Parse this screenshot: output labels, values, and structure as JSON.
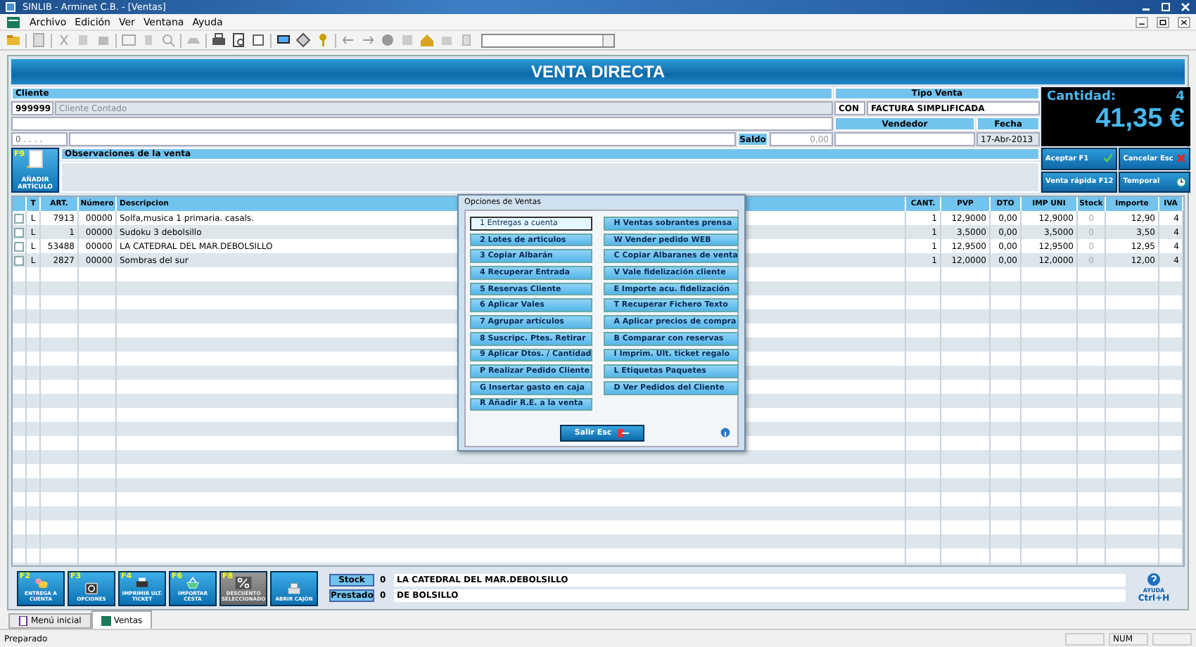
{
  "window": {
    "title": "SINLIB - Arminet C.B. - [Ventas]"
  },
  "menu": [
    "Archivo",
    "Edición",
    "Ver",
    "Ventana",
    "Ayuda"
  ],
  "header": {
    "title": "VENTA DIRECTA"
  },
  "client": {
    "label": "Cliente",
    "code": "999999",
    "name": "Cliente Contado",
    "postal": "0 . . . .",
    "balance_label": "Saldo",
    "balance": "0,00"
  },
  "sale_type": {
    "label": "Tipo Venta",
    "code": "CON",
    "type": "FACTURA SIMPLIFICADA"
  },
  "seller": {
    "label": "Vendedor"
  },
  "date": {
    "label": "Fecha",
    "value": "17-Abr-2013"
  },
  "totals": {
    "quantity_label": "Cantidad:",
    "quantity": "4",
    "total": "41,35 €"
  },
  "observations": {
    "label": "Observaciones de la venta"
  },
  "add_button": {
    "key": "F9",
    "label": "AÑADIR ARTÍCULO"
  },
  "actions": [
    {
      "label": "Aceptar F1",
      "kind": "accept"
    },
    {
      "label": "Cancelar Esc",
      "kind": "cancel"
    },
    {
      "label": "Venta rápida F12",
      "kind": "quick"
    },
    {
      "label": "Temporal",
      "kind": "temporal"
    }
  ],
  "table": {
    "columns": [
      "T",
      "ART.",
      "Número",
      "Descripcion",
      "CANT.",
      "PVP",
      "DTO",
      "IMP UNI",
      "Stock",
      "Importe",
      "IVA"
    ],
    "rows": [
      {
        "checked": false,
        "cells": [
          "L",
          "7913",
          "00000",
          "Solfa,musica 1 primaria. casals.",
          "1",
          "12,9000",
          "0,00",
          "12,9000",
          "0",
          "12,90",
          "4"
        ]
      },
      {
        "checked": false,
        "cells": [
          "L",
          "1",
          "00000",
          "Sudoku 3 debolsillo",
          "1",
          "3,5000",
          "0,00",
          "3,5000",
          "0",
          "3,50",
          "4"
        ]
      },
      {
        "checked": false,
        "cells": [
          "L",
          "53488",
          "00000",
          "LA CATEDRAL DEL MAR.DEBOLSILLO",
          "1",
          "12,9500",
          "0,00",
          "12,9500",
          "0",
          "12,95",
          "4"
        ]
      },
      {
        "checked": false,
        "cells": [
          "L",
          "2827",
          "00000",
          "Sombras del sur",
          "1",
          "12,0000",
          "0,00",
          "12,0000",
          "0",
          "12,00",
          "4"
        ]
      }
    ]
  },
  "dialog": {
    "title": "Opciones de Ventas",
    "options_left": [
      {
        "text": "1 Entregas a cuenta",
        "selected": true
      },
      {
        "text": "2 Lotes de articulos",
        "selected": false
      },
      {
        "text": "3 Copiar Albarán",
        "selected": false
      },
      {
        "text": "4 Recuperar Entrada",
        "selected": false
      },
      {
        "text": "5 Reservas Cliente",
        "selected": false
      },
      {
        "text": "6 Aplicar Vales",
        "selected": false
      },
      {
        "text": "7 Agrupar artículos",
        "selected": false
      },
      {
        "text": "8 Suscripc. Ptes. Retirar",
        "selected": false
      },
      {
        "text": "9 Aplicar Dtos. / Cantidad",
        "selected": false
      },
      {
        "text": "P Realizar Pedido Cliente",
        "selected": false
      },
      {
        "text": "G Insertar gasto en caja",
        "selected": false
      },
      {
        "text": "R Añadir R.E. a la venta",
        "selected": false
      }
    ],
    "options_right": [
      {
        "text": "H Ventas sobrantes prensa",
        "selected": false
      },
      {
        "text": "W Vender pedido WEB",
        "selected": false
      },
      {
        "text": "C Copiar Albaranes de venta",
        "selected": false
      },
      {
        "text": "V Vale fidelización cliente",
        "selected": false
      },
      {
        "text": "E Importe acu. fidelización",
        "selected": false
      },
      {
        "text": "T Recuperar Fichero Texto",
        "selected": false
      },
      {
        "text": "A Aplicar precios de compra",
        "selected": false
      },
      {
        "text": "B Comparar con reservas",
        "selected": false
      },
      {
        "text": "I Imprim. Ult. ticket regalo",
        "selected": false
      },
      {
        "text": "L Etiquetas Paquetes",
        "selected": false
      },
      {
        "text": "D Ver Pedidos del Cliente",
        "selected": false
      }
    ],
    "close_button": "Salir Esc"
  },
  "bottom_buttons": [
    {
      "key": "F2",
      "label": "ENTREGA A CUENTA",
      "kind": "coins",
      "disabled": false
    },
    {
      "key": "F3",
      "label": "OPCIONES",
      "kind": "options",
      "disabled": false
    },
    {
      "key": "F4",
      "label": "IMPRIMIR ULT. TICKET",
      "kind": "printer",
      "disabled": false
    },
    {
      "key": "F6",
      "label": "IMPORTAR CESTA",
      "kind": "basket",
      "disabled": false
    },
    {
      "key": "F8",
      "label": "DESCUENTO SELECCIONADO",
      "kind": "percent",
      "disabled": true
    },
    {
      "label": "ABRIR CAJÓN",
      "kind": "register",
      "disabled": false
    }
  ],
  "stock": {
    "label": "Stock",
    "count": "0",
    "title": "LA CATEDRAL DEL MAR.DEBOLSILLO"
  },
  "loan": {
    "label": "Prestado",
    "count": "0",
    "title": "DE BOLSILLO"
  },
  "help": {
    "label": "AYUDA",
    "shortcut": "Ctrl+H"
  },
  "tabs": [
    {
      "label": "Menú inicial",
      "selected": false
    },
    {
      "label": "Ventas",
      "selected": true
    }
  ],
  "status_bar": {
    "text": "Preparado",
    "indicator": "NUM"
  }
}
